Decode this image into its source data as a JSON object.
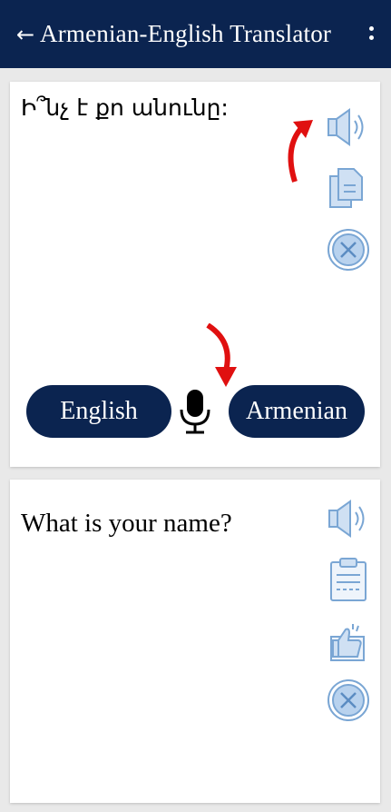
{
  "app_bar": {
    "back_icon": "arrow-left-icon",
    "title": "Armenian-English Translator",
    "menu_icon": "more-vertical-icon",
    "background": "#0b2450"
  },
  "source": {
    "text": "Ի՞նչ է քո անունը:",
    "buttons": {
      "speak_icon": "speaker-icon",
      "copy_icon": "copy-icon",
      "clear_icon": "close-circle-icon"
    },
    "left_language_button": "English",
    "right_language_button": "Armenian",
    "mic_icon": "microphone-icon"
  },
  "result": {
    "text": "What is your name?",
    "buttons": {
      "speak_icon": "speaker-icon",
      "clipboard_icon": "clipboard-icon",
      "share_icon": "thumbs-up-icon",
      "clear_icon": "close-circle-icon"
    }
  },
  "colors": {
    "accent_icon": "#7aa6d4",
    "hint_arrow": "#e01010",
    "page_bg": "#e9e9e9"
  }
}
